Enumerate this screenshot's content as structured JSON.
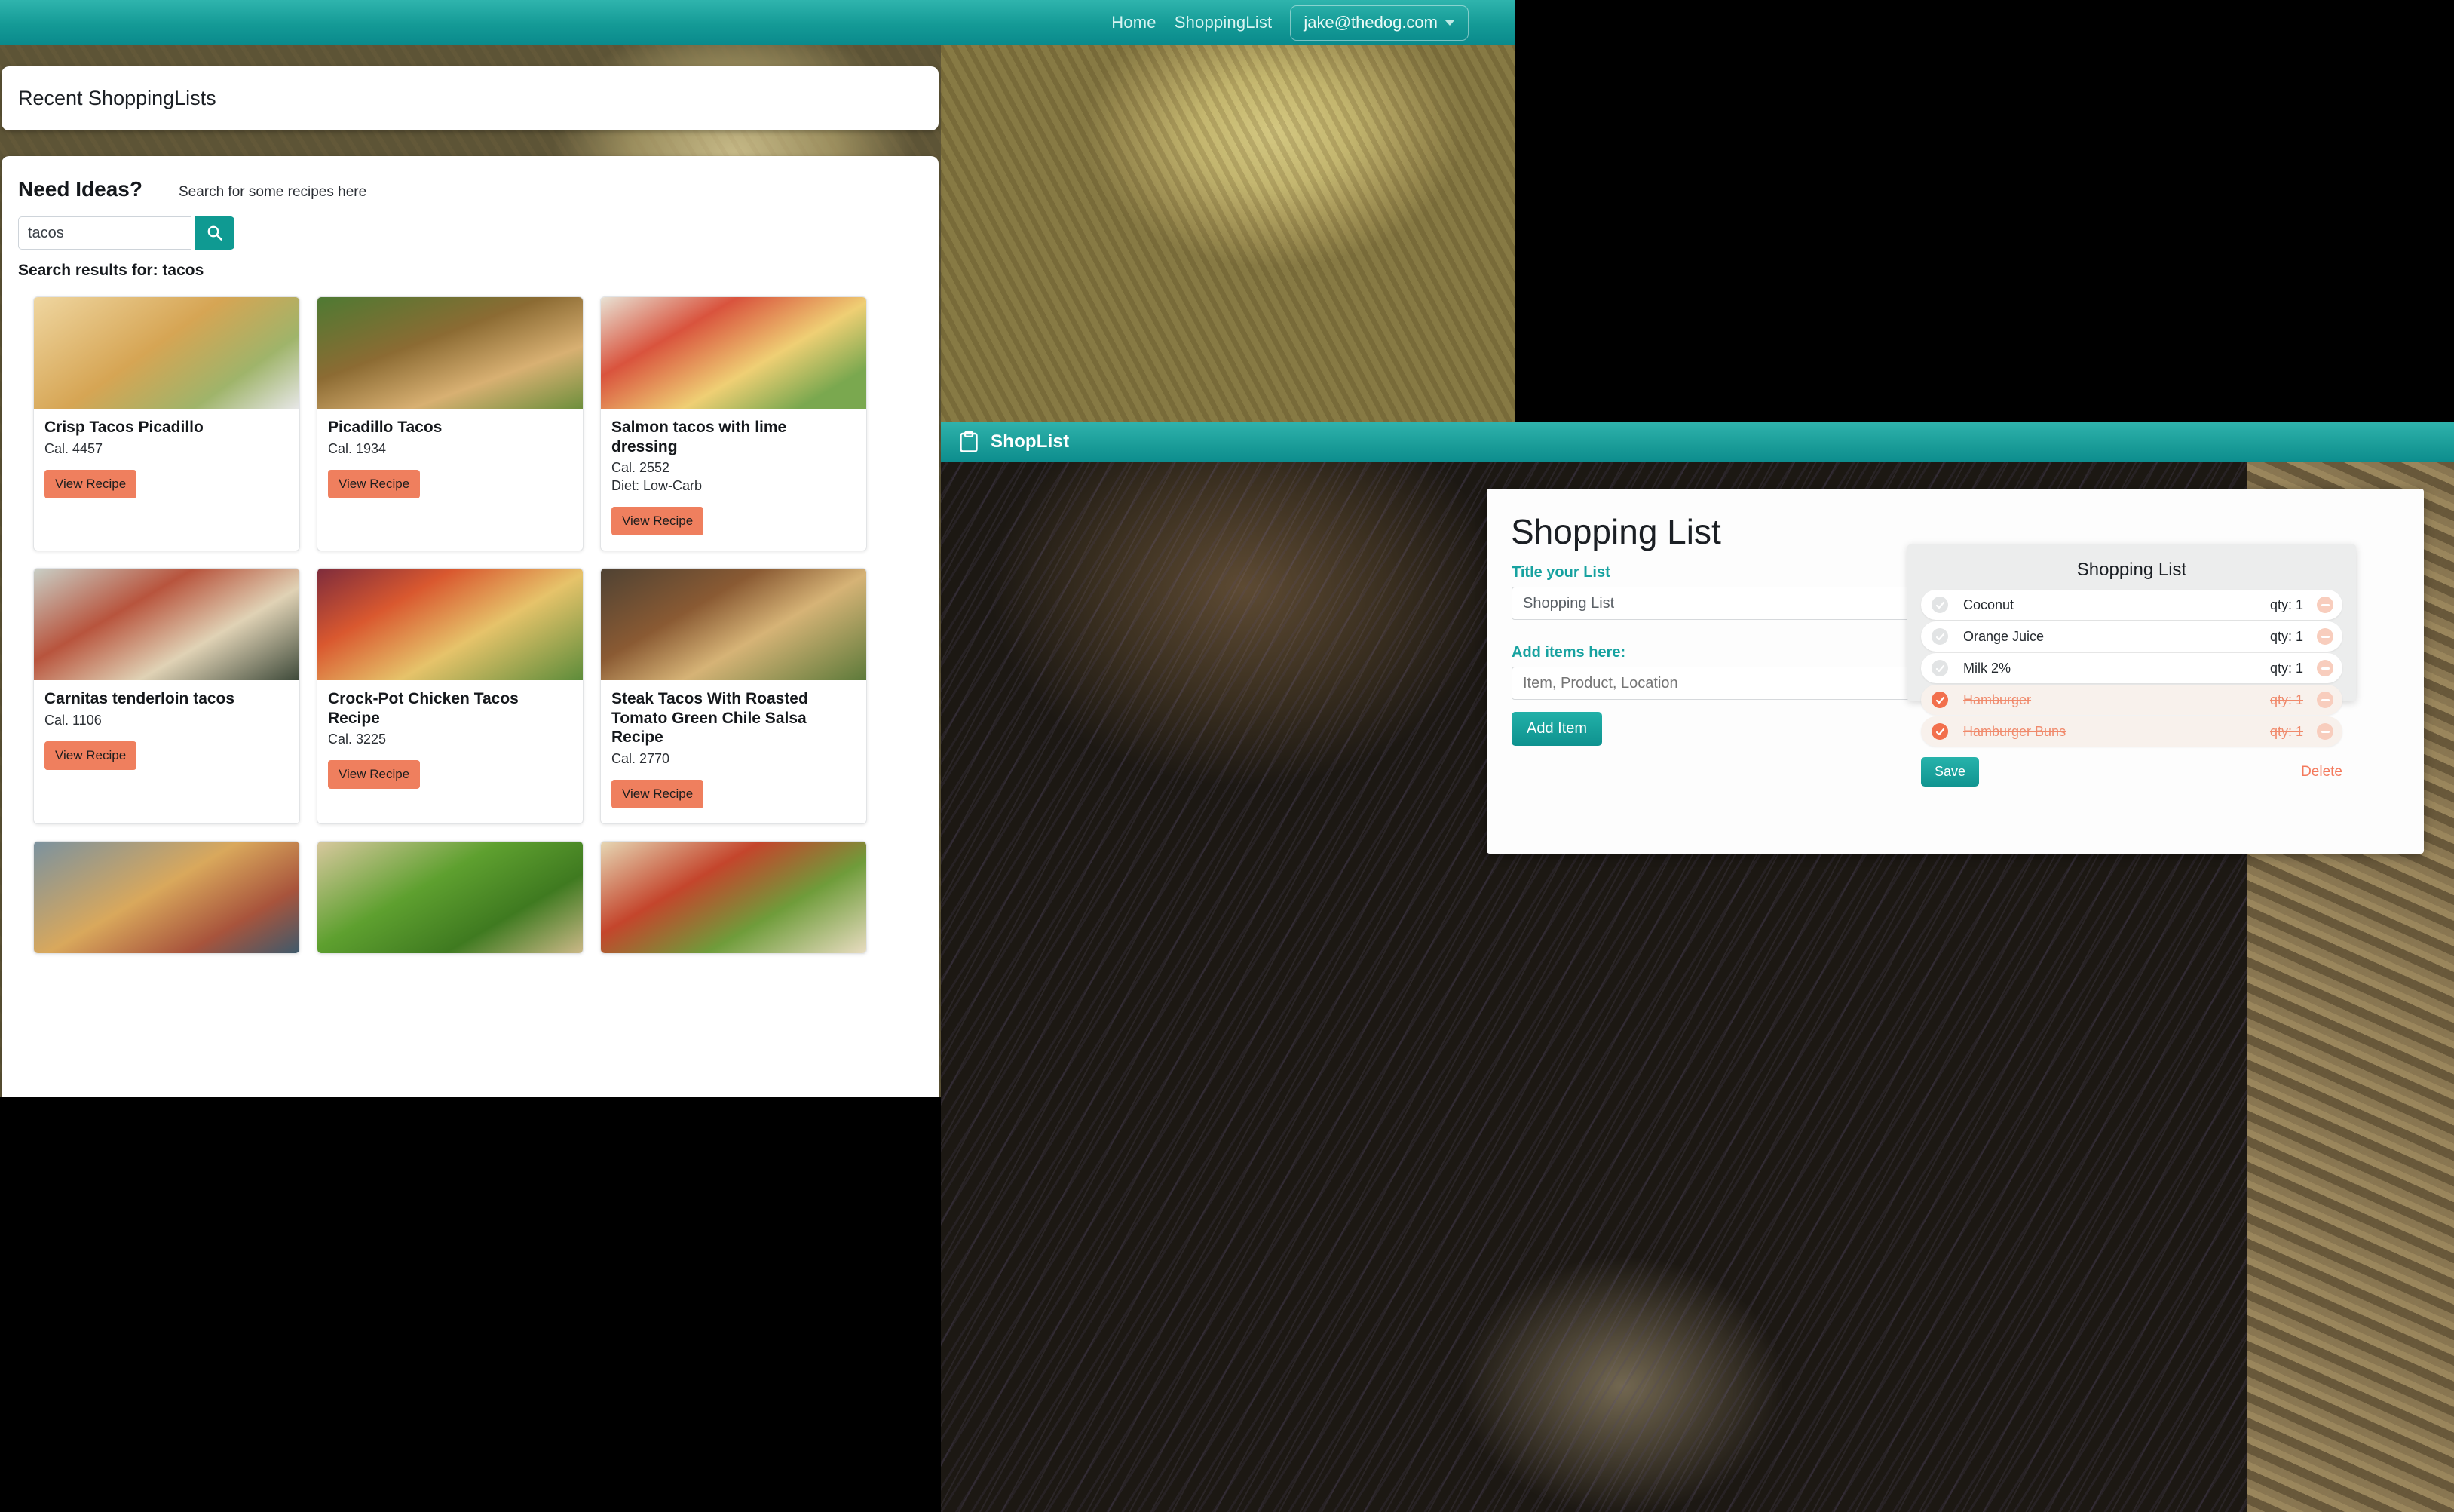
{
  "browser_window": {
    "navbar": {
      "links": [
        {
          "label": "Home",
          "name": "nav-link-home"
        },
        {
          "label": "ShoppingList",
          "name": "nav-link-shoppinglist"
        }
      ],
      "user_menu": "jake@thedog.com"
    },
    "recent_panel": {
      "heading": "Recent ShoppingLists"
    },
    "ideas_panel": {
      "heading": "Need Ideas?",
      "subheading": "Search for some recipes here",
      "search_value": "tacos",
      "search_placeholder": "Search for some recipes here",
      "search_icon": "search-icon",
      "results_label": "Search results for: tacos",
      "view_recipe_label": "View Recipe",
      "recipes": [
        {
          "title": "Crisp Tacos Picadillo",
          "calories": "Cal. 4457",
          "diet": "",
          "img": "f1"
        },
        {
          "title": "Picadillo Tacos",
          "calories": "Cal. 1934",
          "diet": "",
          "img": "f2"
        },
        {
          "title": "Salmon tacos with lime dressing",
          "calories": "Cal. 2552",
          "diet": "Diet: Low-Carb",
          "img": "f3"
        },
        {
          "title": "Carnitas tenderloin tacos",
          "calories": "Cal. 1106",
          "diet": "",
          "img": "f4"
        },
        {
          "title": "Crock-Pot Chicken Tacos Recipe",
          "calories": "Cal. 3225",
          "diet": "",
          "img": "f5"
        },
        {
          "title": "Steak Tacos With Roasted Tomato Green Chile Salsa Recipe",
          "calories": "Cal. 2770",
          "diet": "",
          "img": "f6"
        },
        {
          "title": "",
          "calories": "",
          "diet": "",
          "img": "f7"
        },
        {
          "title": "",
          "calories": "",
          "diet": "",
          "img": "f8"
        },
        {
          "title": "",
          "calories": "",
          "diet": "",
          "img": "f9"
        }
      ]
    }
  },
  "shoplist_window": {
    "titlebar": {
      "app_name": "ShopList",
      "icon": "clipboard-icon"
    },
    "form": {
      "heading": "Shopping List",
      "title_label": "Title your List",
      "title_value": "Shopping List",
      "items_label": "Add items here:",
      "item_placeholder": "Item, Product, Location",
      "item_value": "",
      "add_button": "Add Item"
    },
    "list": {
      "heading": "Shopping List",
      "save_button": "Save",
      "delete_link": "Delete",
      "items": [
        {
          "name": "Coconut",
          "qty": "qty: 1",
          "done": false
        },
        {
          "name": "Orange Juice",
          "qty": "qty: 1",
          "done": false
        },
        {
          "name": "Milk 2%",
          "qty": "qty: 1",
          "done": false
        },
        {
          "name": "Hamburger",
          "qty": "qty: 1",
          "done": true
        },
        {
          "name": "Hamburger Buns",
          "qty": "qty: 1",
          "done": true
        }
      ]
    }
  },
  "colors": {
    "teal": "#0f9a92",
    "teal_light": "#2fb4ad",
    "coral": "#ef7f5e",
    "coral_check": "#f2704d",
    "delete_link": "#f4795c",
    "label_teal": "#17a2a0"
  }
}
